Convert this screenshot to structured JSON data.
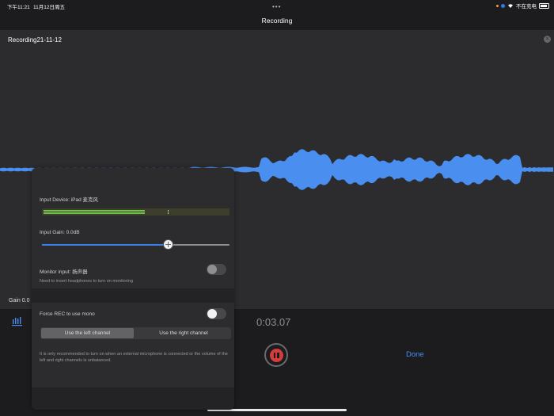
{
  "status_bar": {
    "time": "下午11:21",
    "date": "11月12日周五",
    "charging_text": "不在充电"
  },
  "nav": {
    "title": "Recording",
    "more_dots": "•••"
  },
  "recording": {
    "name": "Recording21-11-12",
    "close_glyph": "×"
  },
  "gain_label": "Gain  0.0",
  "timer": "0:03.07",
  "done_label": "Done",
  "popover": {
    "input_device_label": "Input Device: iPad 麦克风",
    "input_gain_label": "Input Gain: 0.0dB",
    "input_gain_level": 0.67,
    "monitor_label": "Monitor input: 扬声器",
    "monitor_hint": "Need to insert headphones to turn on monitoring",
    "monitor_on": false,
    "force_mono_label": "Force REC to use mono",
    "force_mono_on": false,
    "left_channel_label": "Use the left channel",
    "right_channel_label": "Use the right channel",
    "selected_channel": "left",
    "mono_hint": "It is only recommended to turn on when an external microphone is connected or the volume of the left and right channels is unbalanced."
  },
  "colors": {
    "waveform": "#4a8ef0",
    "accent": "#3a82f0",
    "record": "#d43c3c",
    "meter_green": "#6fc24a"
  },
  "icons": {
    "mixer": "mixer-icon",
    "pause": "pause-icon",
    "close": "close-icon",
    "wifi": "wifi-icon",
    "battery": "battery-icon"
  }
}
